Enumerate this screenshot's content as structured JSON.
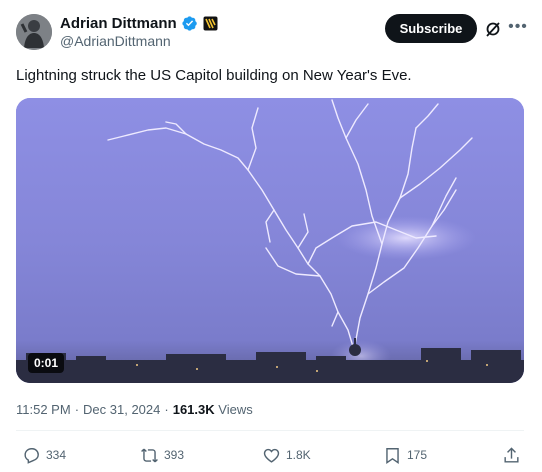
{
  "author": {
    "display_name": "Adrian Dittmann",
    "handle": "@AdrianDittmann"
  },
  "subscribe_label": "Subscribe",
  "tweet": {
    "text": "Lightning struck the US Capitol building on New Year's Eve.",
    "media": {
      "video_timer": "0:01"
    },
    "time": "11:52 PM",
    "date": "Dec 31, 2024",
    "views_count": "161.3K",
    "views_label": "Views"
  },
  "actions": {
    "replies": "334",
    "reposts": "393",
    "likes": "1.8K",
    "bookmarks": "175"
  },
  "colors": {
    "text_primary": "#0f1419",
    "text_secondary": "#536471",
    "verified_blue": "#1d9bf0",
    "media_sky": "#8a8ce0"
  },
  "icons": [
    "verified-badge-icon",
    "affiliation-badge-icon",
    "grok-icon",
    "more-icon",
    "reply-icon",
    "repost-icon",
    "like-icon",
    "bookmark-icon",
    "share-icon"
  ]
}
